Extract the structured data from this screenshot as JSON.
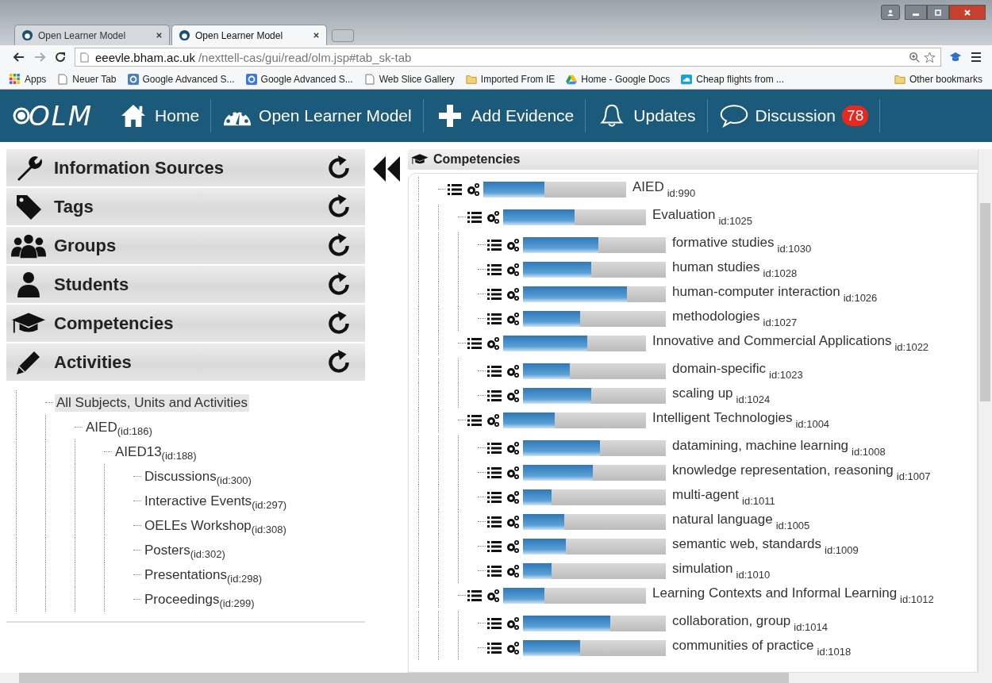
{
  "browser": {
    "tabs": [
      {
        "title": "Open Learner Model",
        "selected": false
      },
      {
        "title": "Open Learner Model",
        "selected": true
      }
    ],
    "url": {
      "host": "eeevle.bham.ac.uk",
      "path": "/nexttell-cas/gui/read/olm.jsp#tab_sk-tab"
    },
    "bookmarks": [
      {
        "kind": "apps",
        "label": "Apps"
      },
      {
        "kind": "page",
        "label": "Neuer Tab"
      },
      {
        "kind": "google-grey",
        "label": "Google Advanced S..."
      },
      {
        "kind": "google-blue",
        "label": "Google Advanced S..."
      },
      {
        "kind": "page",
        "label": "Web Slice Gallery"
      },
      {
        "kind": "folder",
        "label": "Imported From IE"
      },
      {
        "kind": "drive",
        "label": "Home - Google Docs"
      },
      {
        "kind": "flights",
        "label": "Cheap flights from ..."
      }
    ],
    "other_bookmarks": "Other bookmarks"
  },
  "nav": {
    "logo": "OLM",
    "items": [
      {
        "kind": "home",
        "label": "Home"
      },
      {
        "kind": "gauge",
        "label": "Open Learner Model"
      },
      {
        "kind": "plus",
        "label": "Add Evidence"
      },
      {
        "kind": "bell",
        "label": "Updates"
      },
      {
        "kind": "chat",
        "label": "Discussion",
        "badge": "78"
      }
    ]
  },
  "sidebar": {
    "sections": [
      {
        "kind": "wrench",
        "label": "Information Sources"
      },
      {
        "kind": "tag",
        "label": "Tags"
      },
      {
        "kind": "group",
        "label": "Groups"
      },
      {
        "kind": "user",
        "label": "Students"
      },
      {
        "kind": "cap",
        "label": "Competencies"
      },
      {
        "kind": "pencil",
        "label": "Activities"
      }
    ],
    "activities": [
      {
        "name": "All Subjects, Units and Activities",
        "selected": true,
        "children": [
          {
            "name": "AIED",
            "id": "(id:186)",
            "selected": false,
            "children": [
              {
                "name": "AIED13",
                "id": "(id:188)",
                "selected": false,
                "children": [
                  {
                    "name": "Discussions",
                    "id": "(id:300)",
                    "selected": false
                  },
                  {
                    "name": "Interactive Events",
                    "id": "(id:297)",
                    "selected": false
                  },
                  {
                    "name": "OELEs Workshop",
                    "id": "(id:308)",
                    "selected": false
                  },
                  {
                    "name": "Posters",
                    "id": "(id:302)",
                    "selected": false
                  },
                  {
                    "name": "Presentations",
                    "id": "(id:298)",
                    "selected": false
                  },
                  {
                    "name": "Proceedings",
                    "id": "(id:299)",
                    "selected": false
                  }
                ]
              }
            ]
          }
        ]
      }
    ]
  },
  "competencies": {
    "title": "Competencies",
    "tree": [
      {
        "name": "AIED",
        "id": "id:990",
        "level": 0.43,
        "children": [
          {
            "name": "Evaluation",
            "id": "id:1025",
            "level": 0.5,
            "children": [
              {
                "name": "formative studies",
                "id": "id:1030",
                "level": 0.53
              },
              {
                "name": "human studies",
                "id": "id:1028",
                "level": 0.48
              },
              {
                "name": "human-computer interaction",
                "id": "id:1026",
                "level": 0.73
              },
              {
                "name": "methodologies",
                "id": "id:1027",
                "level": 0.4
              }
            ]
          },
          {
            "name": "Innovative and Commercial Applications",
            "id": "id:1022",
            "level": 0.59,
            "children": [
              {
                "name": "domain-specific",
                "id": "id:1023",
                "level": 0.33
              },
              {
                "name": "scaling up",
                "id": "id:1024",
                "level": 0.48
              }
            ]
          },
          {
            "name": "Intelligent Technologies",
            "id": "id:1004",
            "level": 0.36,
            "children": [
              {
                "name": "datamining, machine learning",
                "id": "id:1008",
                "level": 0.54
              },
              {
                "name": "knowledge representation, reasoning",
                "id": "id:1007",
                "level": 0.49
              },
              {
                "name": "multi-agent",
                "id": "id:1011",
                "level": 0.2
              },
              {
                "name": "natural language",
                "id": "id:1005",
                "level": 0.29
              },
              {
                "name": "semantic web, standards",
                "id": "id:1009",
                "level": 0.3
              },
              {
                "name": "simulation",
                "id": "id:1010",
                "level": 0.2
              }
            ]
          },
          {
            "name": "Learning Contexts and Informal Learning",
            "id": "id:1012",
            "level": 0.29,
            "children": [
              {
                "name": "collaboration, group",
                "id": "id:1014",
                "level": 0.61
              },
              {
                "name": "communities of practice",
                "id": "id:1018",
                "level": 0.4
              }
            ]
          }
        ]
      }
    ]
  }
}
